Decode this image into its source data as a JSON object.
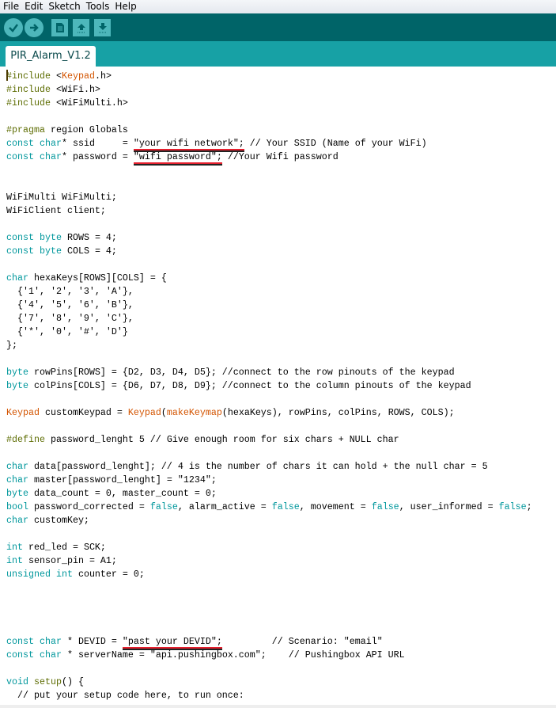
{
  "menu": [
    "File",
    "Edit",
    "Sketch",
    "Tools",
    "Help"
  ],
  "toolbar": {
    "buttons": [
      {
        "name": "verify-button",
        "icon": "check-icon"
      },
      {
        "name": "upload-button",
        "icon": "arrow-right-icon"
      },
      {
        "name": "new-button",
        "icon": "document-icon"
      },
      {
        "name": "open-button",
        "icon": "arrow-up-icon"
      },
      {
        "name": "save-button",
        "icon": "arrow-down-icon"
      }
    ]
  },
  "tab": {
    "label": "PIR_Alarm_V1.2"
  },
  "colors": {
    "toolbar": "#006468",
    "tabstrip": "#17a1a5",
    "keyword": "#00979c",
    "preprocessor": "#5e6d03",
    "class": "#d35400"
  },
  "code": [
    [
      [
        "p",
        "#include"
      ],
      [
        "",
        "<"
      ],
      [
        "o",
        "Keypad"
      ],
      [
        "",
        ".h>"
      ]
    ],
    [
      [
        "p",
        "#include"
      ],
      [
        "",
        "<WiFi.h>"
      ]
    ],
    [
      [
        "p",
        "#include"
      ],
      [
        "",
        "<WiFiMulti.h>"
      ]
    ],
    [],
    [
      [
        "p",
        "#pragma"
      ],
      [
        "",
        " region Globals"
      ]
    ],
    [
      [
        "k",
        "const"
      ],
      [
        "",
        ""
      ],
      [
        "k",
        " char"
      ],
      [
        "",
        "* ssid     = "
      ],
      [
        "u",
        "\"your wifi network\";"
      ],
      [
        "",
        " // Your SSID (Name of your WiFi)"
      ]
    ],
    [
      [
        "k",
        "const"
      ],
      [
        "k",
        " char"
      ],
      [
        "",
        "* password = "
      ],
      [
        "u",
        "\"wifi password\";"
      ],
      [
        "",
        " //Your Wifi password"
      ]
    ],
    [],
    [],
    [
      [
        "",
        "WiFiMulti WiFiMulti;"
      ]
    ],
    [
      [
        "",
        "WiFiClient client;"
      ]
    ],
    [],
    [
      [
        "k",
        "const"
      ],
      [
        "k",
        " byte"
      ],
      [
        "",
        " ROWS = 4;"
      ]
    ],
    [
      [
        "k",
        "const"
      ],
      [
        "k",
        " byte"
      ],
      [
        "",
        " COLS = 4;"
      ]
    ],
    [],
    [
      [
        "k",
        "char"
      ],
      [
        "",
        " hexaKeys[ROWS][COLS] = {"
      ]
    ],
    [
      [
        "",
        "  {'1', '2', '3', 'A'},"
      ]
    ],
    [
      [
        "",
        "  {'4', '5', '6', 'B'},"
      ]
    ],
    [
      [
        "",
        "  {'7', '8', '9', 'C'},"
      ]
    ],
    [
      [
        "",
        "  {'*', '0', '#', 'D'}"
      ]
    ],
    [
      [
        "",
        "};"
      ]
    ],
    [],
    [
      [
        "k",
        "byte"
      ],
      [
        "",
        " rowPins[ROWS] = {D2, D3, D4, D5}; //connect to the row pinouts of the keypad"
      ]
    ],
    [
      [
        "k",
        "byte"
      ],
      [
        "",
        " colPins[COLS] = {D6, D7, D8, D9}; //connect to the column pinouts of the keypad"
      ]
    ],
    [],
    [
      [
        "o",
        "Keypad"
      ],
      [
        "",
        " customKeypad = "
      ],
      [
        "o",
        "Keypad"
      ],
      [
        "",
        "("
      ],
      [
        "o",
        "makeKeymap"
      ],
      [
        "",
        "(hexaKeys), rowPins, colPins, ROWS, COLS);"
      ]
    ],
    [],
    [
      [
        "p",
        "#define"
      ],
      [
        "",
        " password_lenght 5 // Give enough room for six chars + NULL char"
      ]
    ],
    [],
    [
      [
        "k",
        "char"
      ],
      [
        "",
        " data[password_lenght]; // 4 is the number of chars it can hold + the null char = 5"
      ]
    ],
    [
      [
        "k",
        "char"
      ],
      [
        "",
        " master[password_lenght] = \"1234\";"
      ]
    ],
    [
      [
        "k",
        "byte"
      ],
      [
        "",
        " data_count = 0, master_count = 0;"
      ]
    ],
    [
      [
        "k",
        "bool"
      ],
      [
        "",
        " password_corrected = "
      ],
      [
        "k",
        "false"
      ],
      [
        "",
        ", alarm_active = "
      ],
      [
        "k",
        "false"
      ],
      [
        "",
        ", movement = "
      ],
      [
        "k",
        "false"
      ],
      [
        "",
        ", user_informed = "
      ],
      [
        "k",
        "false"
      ],
      [
        "",
        ";"
      ]
    ],
    [
      [
        "k",
        "char"
      ],
      [
        "",
        " customKey;"
      ]
    ],
    [],
    [
      [
        "k",
        "int"
      ],
      [
        "",
        " red_led = SCK;"
      ]
    ],
    [
      [
        "k",
        "int"
      ],
      [
        "",
        " sensor_pin = A1;"
      ]
    ],
    [
      [
        "k",
        "unsigned"
      ],
      [
        "k",
        " int"
      ],
      [
        "",
        " counter = 0;"
      ]
    ],
    [],
    [],
    [],
    [],
    [
      [
        "k",
        "const"
      ],
      [
        "k",
        " char"
      ],
      [
        "",
        " * DEVID = "
      ],
      [
        "u",
        "\"past your DEVID\";"
      ],
      [
        "",
        "         // Scenario: \"email\""
      ]
    ],
    [
      [
        "k",
        "const"
      ],
      [
        "k",
        " char"
      ],
      [
        "",
        " * serverName = \"api.pushingbox.com\";    // Pushingbox API URL"
      ]
    ],
    [],
    [
      [
        "k",
        "void"
      ],
      [
        "",
        " "
      ],
      [
        "p",
        "setup"
      ],
      [
        "",
        "() {"
      ]
    ],
    [
      [
        "",
        "  // put your setup code here, to run once:"
      ]
    ]
  ]
}
